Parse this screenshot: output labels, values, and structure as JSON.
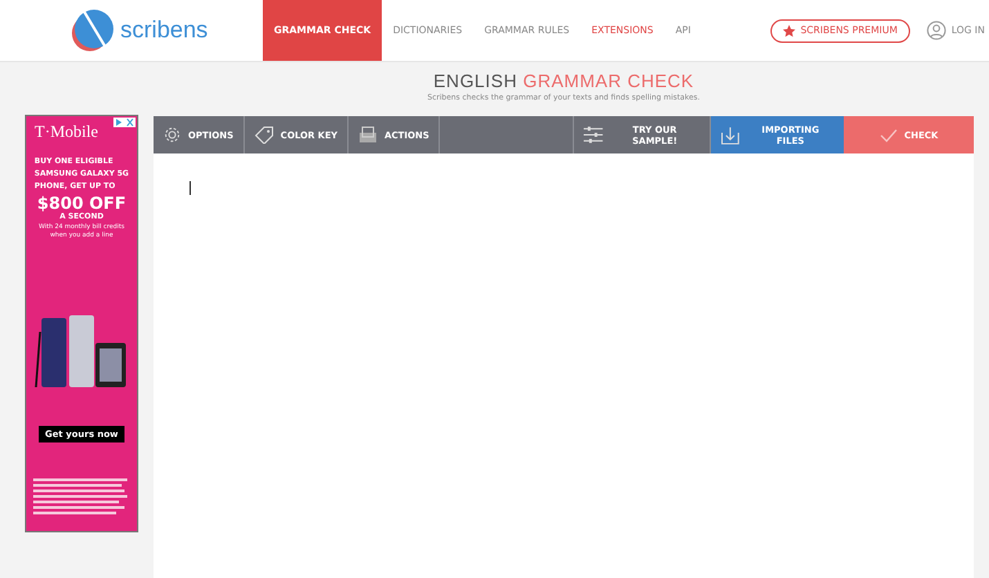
{
  "header": {
    "logo": "scribens",
    "nav": [
      {
        "label": "GRAMMAR CHECK",
        "selected": true,
        "highlight": false
      },
      {
        "label": "DICTIONARIES",
        "selected": false,
        "highlight": false
      },
      {
        "label": "GRAMMAR RULES",
        "selected": false,
        "highlight": false
      },
      {
        "label": "EXTENSIONS",
        "selected": false,
        "highlight": true
      },
      {
        "label": "API",
        "selected": false,
        "highlight": false
      }
    ],
    "premium": "SCRIBENS PREMIUM",
    "login": "LOG IN"
  },
  "heading": {
    "title": "ENGLISH",
    "title_accent": "GRAMMAR CHECK",
    "subtitle": "Scribens checks the grammar of your texts and finds spelling mistakes."
  },
  "ad": {
    "brand": "T·Mobile",
    "lines": [
      "BUY ONE ELIGIBLE",
      "SAMSUNG GALAXY 5G",
      "PHONE, GET UP TO"
    ],
    "offer": "$800 OFF",
    "offer_note": "A SECOND",
    "terms": "With 24 monthly bill credits when you add a line",
    "cta": "Get yours now"
  },
  "toolbar": [
    {
      "label": "OPTIONS",
      "kind": "gear"
    },
    {
      "label": "COLOR KEY",
      "kind": "tag"
    },
    {
      "label": "ACTIONS",
      "kind": "tray"
    },
    {
      "label": "TRY OUR SAMPLE!",
      "kind": "sliders"
    },
    {
      "label": "IMPORTING FILES",
      "kind": "import"
    },
    {
      "label": "CHECK",
      "kind": "check"
    }
  ]
}
